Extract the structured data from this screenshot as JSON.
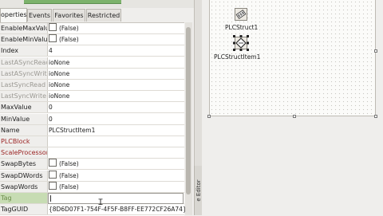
{
  "tabs": [
    {
      "label": "operties",
      "active": true
    },
    {
      "label": "Events",
      "active": false
    },
    {
      "label": "Favorites",
      "active": false
    },
    {
      "label": "Restricted",
      "active": false
    }
  ],
  "properties": [
    {
      "name": "EnableMaxValue",
      "value": "(False)",
      "checkbox": true,
      "style": "normal"
    },
    {
      "name": "EnableMinValue",
      "value": "(False)",
      "checkbox": true,
      "style": "normal"
    },
    {
      "name": "Index",
      "value": "4",
      "checkbox": false,
      "style": "normal"
    },
    {
      "name": "LastASyncRead",
      "value": "ioNone",
      "checkbox": false,
      "style": "dim"
    },
    {
      "name": "LastASyncWrite",
      "value": "ioNone",
      "checkbox": false,
      "style": "dim"
    },
    {
      "name": "LastSyncRead",
      "value": "ioNone",
      "checkbox": false,
      "style": "dim"
    },
    {
      "name": "LastSyncWrite",
      "value": "ioNone",
      "checkbox": false,
      "style": "dim"
    },
    {
      "name": "MaxValue",
      "value": "0",
      "checkbox": false,
      "style": "normal"
    },
    {
      "name": "MinValue",
      "value": "0",
      "checkbox": false,
      "style": "normal"
    },
    {
      "name": "Name",
      "value": "PLCStructItem1",
      "checkbox": false,
      "style": "normal"
    },
    {
      "name": "PLCBlock",
      "value": "",
      "checkbox": false,
      "style": "red"
    },
    {
      "name": "ScaleProcessor",
      "value": "",
      "checkbox": false,
      "style": "red"
    },
    {
      "name": "SwapBytes",
      "value": "(False)",
      "checkbox": true,
      "style": "normal"
    },
    {
      "name": "SwapDWords",
      "value": "(False)",
      "checkbox": true,
      "style": "normal"
    },
    {
      "name": "SwapWords",
      "value": "(False)",
      "checkbox": true,
      "style": "normal"
    },
    {
      "name": "Tag",
      "value": "",
      "checkbox": false,
      "style": "selected"
    },
    {
      "name": "TagGUID",
      "value": "{8D6D07F1-754F-4F5F-B8FF-EE772CF26A74}",
      "checkbox": false,
      "style": "normal"
    }
  ],
  "editor_tab_label": "e Editor",
  "components": [
    {
      "label": "PLCStruct1",
      "icon": "plc-struct-icon"
    },
    {
      "label": "PLCStructItem1",
      "icon": "plc-struct-item-icon"
    }
  ]
}
